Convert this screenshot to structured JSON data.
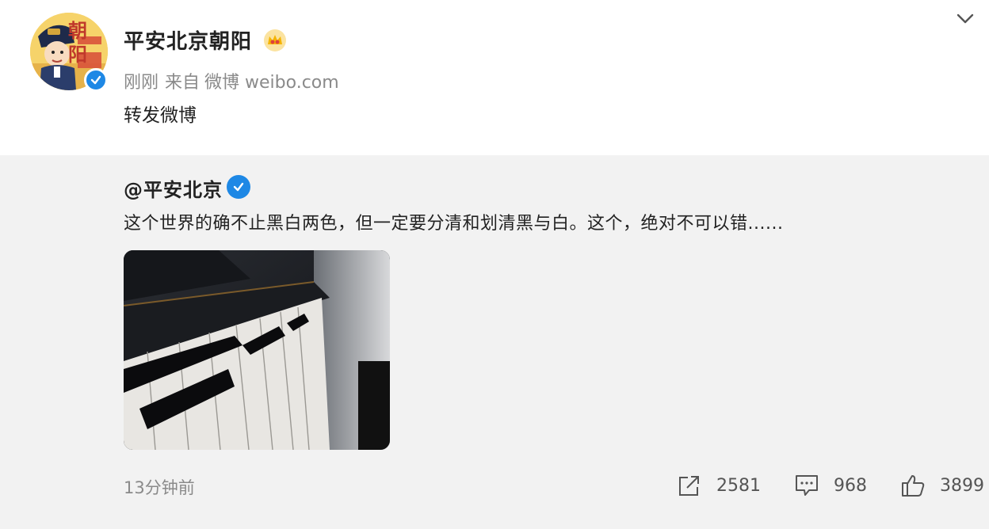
{
  "post": {
    "author": "平安北京朝阳",
    "avatar_text": "朝阳",
    "meta": {
      "time": "刚刚",
      "source_prefix": "来自",
      "source": "微博 weibo.com"
    },
    "content": "转发微博"
  },
  "quoted": {
    "author": "@平安北京",
    "content": "这个世界的确不止黑白两色，但一定要分清和划清黑与白。这个，绝对不可以错......",
    "timestamp": "13分钟前"
  },
  "actions": {
    "share_count": "2581",
    "comment_count": "968",
    "like_count": "3899"
  },
  "colors": {
    "verified_blue": "#1e88e5",
    "meta_gray": "#8a8a8a",
    "quoted_bg": "#f2f2f2",
    "crown_gold": "#f5b400"
  },
  "icons": {
    "verified": "verified-icon",
    "crown": "crown-icon",
    "expand": "chevron-down-icon",
    "share": "share-icon",
    "comment": "comment-icon",
    "like": "like-icon"
  }
}
